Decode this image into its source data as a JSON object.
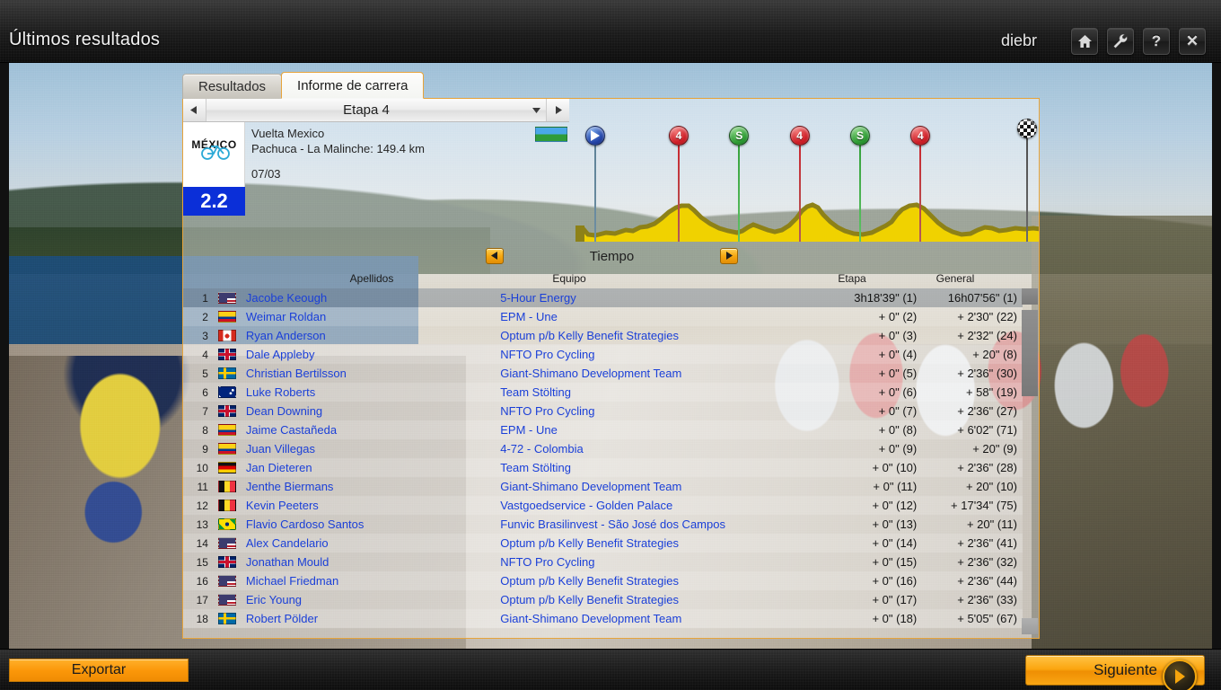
{
  "window": {
    "title": "Últimos resultados",
    "user": "diebr",
    "buttons": [
      {
        "name": "home-button",
        "icon": "home-icon"
      },
      {
        "name": "tools-button",
        "icon": "wrench-icon"
      },
      {
        "name": "help-button",
        "icon": "question-mark-icon",
        "glyph": "?"
      },
      {
        "name": "close-button",
        "icon": "close-icon",
        "glyph": "✕"
      }
    ]
  },
  "tabs": [
    {
      "label": "Resultados",
      "active": false
    },
    {
      "label": "Informe de carrera",
      "active": true
    }
  ],
  "stage_selector": {
    "label": "Etapa 4",
    "prev_icon": "triangle-left-icon",
    "next_icon": "triangle-right-icon",
    "dropdown_icon": "chevron-down-icon"
  },
  "race_info": {
    "logo_text": "MÉXICO",
    "rating": "2.2",
    "name": "Vuelta Mexico",
    "route": "Pachuca - La Malinche: 149.4 km",
    "date": "07/03",
    "flag_colors": [
      "#4aa8e8",
      "#2f9c3a"
    ]
  },
  "profile": {
    "markers": [
      {
        "type": "start",
        "label": "",
        "pos": 4,
        "color": "#2344a8"
      },
      {
        "type": "cat",
        "label": "4",
        "pos": 22,
        "color": "#cf1f28"
      },
      {
        "type": "sprint",
        "label": "S",
        "pos": 35,
        "color": "#2e9c34"
      },
      {
        "type": "cat",
        "label": "4",
        "pos": 48,
        "color": "#cf1f28"
      },
      {
        "type": "sprint",
        "label": "S",
        "pos": 61,
        "color": "#2e9c34"
      },
      {
        "type": "cat",
        "label": "4",
        "pos": 74,
        "color": "#cf1f28"
      },
      {
        "type": "finish",
        "label": "",
        "pos": 97,
        "color": "#333333"
      }
    ],
    "terrain_color": "#f0d200",
    "terrain_shade": "#8d8118"
  },
  "time_nav": {
    "label": "Tiempo",
    "prev_icon": "triangle-left-icon",
    "next_icon": "triangle-right-icon"
  },
  "table": {
    "headers": {
      "name": "Apellidos",
      "team": "Equipo",
      "stage": "Etapa",
      "gc": "General"
    },
    "rows": [
      {
        "pos": "1",
        "country": "us",
        "name": "Jacobe Keough",
        "team": "5-Hour Energy",
        "stage": "3h18'39\" (1)",
        "gc": "16h07'56\" (1)",
        "selected": true
      },
      {
        "pos": "2",
        "country": "co",
        "name": "Weimar Roldan",
        "team": "EPM - Une",
        "stage": "+ 0\" (2)",
        "gc": "+ 2'30\" (22)",
        "selected": false
      },
      {
        "pos": "3",
        "country": "ca",
        "name": "Ryan Anderson",
        "team": "Optum p/b Kelly Benefit Strategies",
        "stage": "+ 0\" (3)",
        "gc": "+ 2'32\" (24)",
        "selected": false
      },
      {
        "pos": "4",
        "country": "gb",
        "name": "Dale Appleby",
        "team": "NFTO Pro Cycling",
        "stage": "+ 0\" (4)",
        "gc": "+ 20\" (8)",
        "selected": false
      },
      {
        "pos": "5",
        "country": "se",
        "name": "Christian Bertilsson",
        "team": "Giant-Shimano Development Team",
        "stage": "+ 0\" (5)",
        "gc": "+ 2'36\" (30)",
        "selected": false
      },
      {
        "pos": "6",
        "country": "au",
        "name": "Luke Roberts",
        "team": "Team Stölting",
        "stage": "+ 0\" (6)",
        "gc": "+ 58\" (19)",
        "selected": false
      },
      {
        "pos": "7",
        "country": "gb",
        "name": "Dean Downing",
        "team": "NFTO Pro Cycling",
        "stage": "+ 0\" (7)",
        "gc": "+ 2'36\" (27)",
        "selected": false
      },
      {
        "pos": "8",
        "country": "co",
        "name": "Jaime  Castañeda",
        "team": "EPM - Une",
        "stage": "+ 0\" (8)",
        "gc": "+ 6'02\" (71)",
        "selected": false
      },
      {
        "pos": "9",
        "country": "co",
        "name": "Juan  Villegas",
        "team": "4-72 - Colombia",
        "stage": "+ 0\" (9)",
        "gc": "+ 20\" (9)",
        "selected": false
      },
      {
        "pos": "10",
        "country": "de",
        "name": "Jan Dieteren",
        "team": "Team Stölting",
        "stage": "+ 0\" (10)",
        "gc": "+ 2'36\" (28)",
        "selected": false
      },
      {
        "pos": "11",
        "country": "be",
        "name": "Jenthe Biermans",
        "team": "Giant-Shimano Development Team",
        "stage": "+ 0\" (11)",
        "gc": "+ 20\" (10)",
        "selected": false
      },
      {
        "pos": "12",
        "country": "be",
        "name": "Kevin Peeters",
        "team": "Vastgoedservice - Golden Palace",
        "stage": "+ 0\" (12)",
        "gc": "+ 17'34\" (75)",
        "selected": false
      },
      {
        "pos": "13",
        "country": "br",
        "name": "Flavio Cardoso Santos",
        "team": "Funvic Brasilinvest - São José dos Campos",
        "stage": "+ 0\" (13)",
        "gc": "+ 20\" (11)",
        "selected": false
      },
      {
        "pos": "14",
        "country": "us",
        "name": "Alex Candelario",
        "team": "Optum p/b Kelly Benefit Strategies",
        "stage": "+ 0\" (14)",
        "gc": "+ 2'36\" (41)",
        "selected": false
      },
      {
        "pos": "15",
        "country": "gb",
        "name": "Jonathan Mould",
        "team": "NFTO Pro Cycling",
        "stage": "+ 0\" (15)",
        "gc": "+ 2'36\" (32)",
        "selected": false
      },
      {
        "pos": "16",
        "country": "us",
        "name": "Michael Friedman",
        "team": "Optum p/b Kelly Benefit Strategies",
        "stage": "+ 0\" (16)",
        "gc": "+ 2'36\" (44)",
        "selected": false
      },
      {
        "pos": "17",
        "country": "us",
        "name": "Eric Young",
        "team": "Optum p/b Kelly Benefit Strategies",
        "stage": "+ 0\" (17)",
        "gc": "+ 2'36\" (33)",
        "selected": false
      },
      {
        "pos": "18",
        "country": "se",
        "name": "Robert Pölder",
        "team": "Giant-Shimano Development Team",
        "stage": "+ 0\" (18)",
        "gc": "+ 5'05\" (67)",
        "selected": false
      }
    ]
  },
  "footer": {
    "export_label": "Exportar",
    "next_label": "Siguiente",
    "next_icon": "triangle-right-icon"
  },
  "colors": {
    "accent": "#f7a50c",
    "link": "#1a3fd8",
    "tab_border": "#e6a33a"
  }
}
